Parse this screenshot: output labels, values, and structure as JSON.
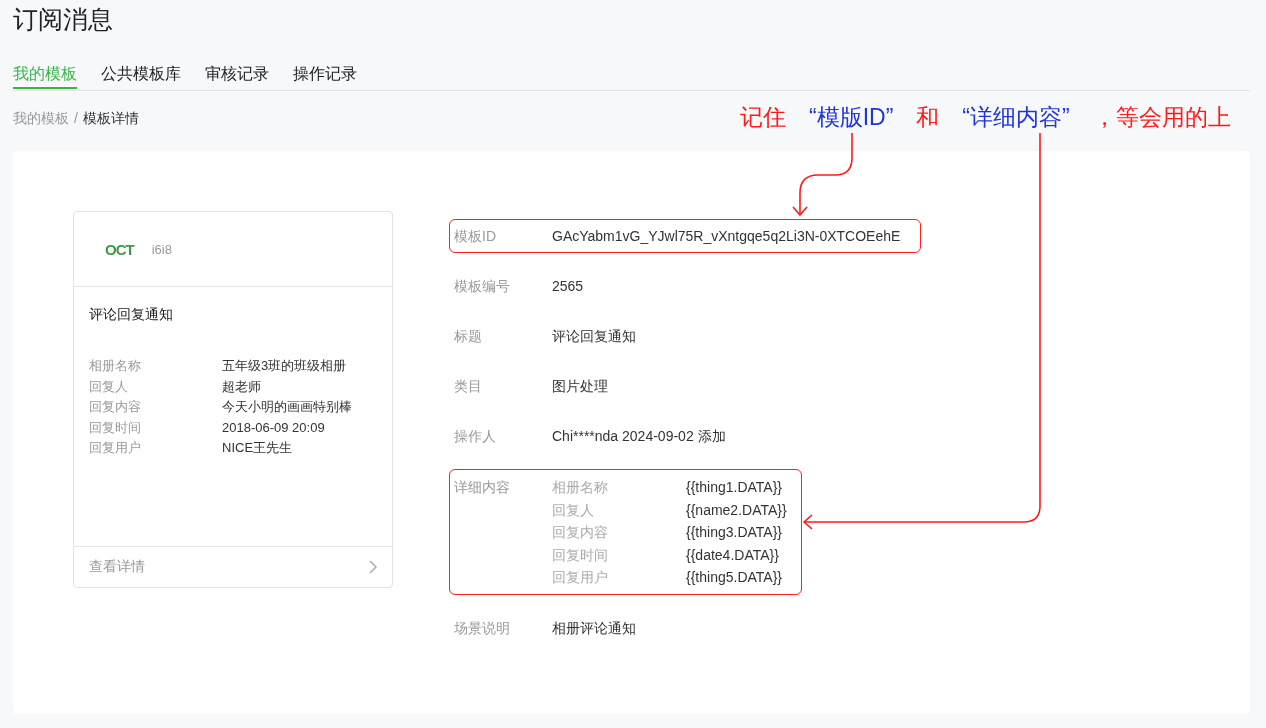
{
  "page": {
    "title": "订阅消息"
  },
  "tabs": [
    {
      "label": "我的模板",
      "selected": true
    },
    {
      "label": "公共模板库",
      "selected": false
    },
    {
      "label": "审核记录",
      "selected": false
    },
    {
      "label": "操作记录",
      "selected": false
    }
  ],
  "breadcrumb": {
    "separator": "/",
    "items": [
      {
        "label": "我的模板",
        "current": false
      },
      {
        "label": "模板详情",
        "current": true
      }
    ]
  },
  "annotation": {
    "segments": [
      {
        "text": "记住",
        "color": "#ff1a1a"
      },
      {
        "text": "“模版ID”",
        "color": "#1f35d8"
      },
      {
        "text": "和",
        "color": "#ff1a1a"
      },
      {
        "text": "“详细内容”",
        "color": "#1f35d8"
      },
      {
        "text": "，等会用的上",
        "color": "#ff1a1a"
      }
    ]
  },
  "preview_card": {
    "logo": "OCT",
    "account": "i6i8",
    "title": "评论回复通知",
    "fields": [
      {
        "label": "相册名称",
        "value": "五年级3班的班级相册"
      },
      {
        "label": "回复人",
        "value": "超老师"
      },
      {
        "label": "回复内容",
        "value": "今天小明的画画特别棒"
      },
      {
        "label": "回复时间",
        "value": "2018-06-09 20:09"
      },
      {
        "label": "回复用户",
        "value": "NICE王先生"
      }
    ],
    "footer_link": "查看详情"
  },
  "details": [
    {
      "kind": "text",
      "label": "模板ID",
      "value": "GAcYabm1vG_YJwl75R_vXntgqe5q2Li3N-0XTCOEehE",
      "highlighted": true
    },
    {
      "kind": "text",
      "label": "模板编号",
      "value": "2565",
      "highlighted": false
    },
    {
      "kind": "text",
      "label": "标题",
      "value": "评论回复通知",
      "highlighted": false
    },
    {
      "kind": "text",
      "label": "类目",
      "value": "图片处理",
      "highlighted": false
    },
    {
      "kind": "text",
      "label": "操作人",
      "value": "Chi****nda 2024-09-02 添加",
      "highlighted": false
    },
    {
      "kind": "fields",
      "label": "详细内容",
      "highlighted": true,
      "fields": [
        {
          "label": "相册名称",
          "value": "{{thing1.DATA}}"
        },
        {
          "label": "回复人",
          "value": "{{name2.DATA}}"
        },
        {
          "label": "回复内容",
          "value": "{{thing3.DATA}}"
        },
        {
          "label": "回复时间",
          "value": "{{date4.DATA}}"
        },
        {
          "label": "回复用户",
          "value": "{{thing5.DATA}}"
        }
      ]
    },
    {
      "kind": "text",
      "label": "场景说明",
      "value": "相册评论通知",
      "highlighted": false
    }
  ]
}
